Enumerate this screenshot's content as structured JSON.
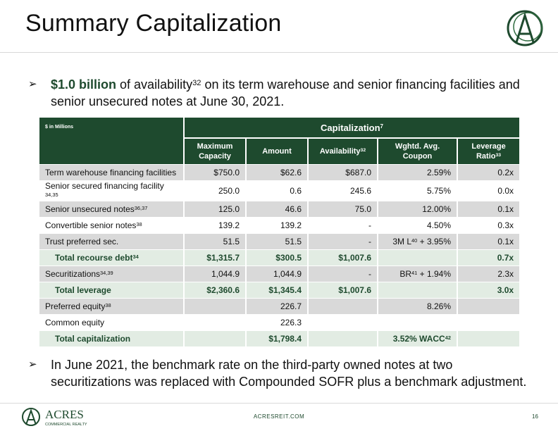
{
  "title": "Summary Capitalization",
  "bullet1": {
    "arrow": "➢",
    "bold": "$1.0 billion",
    "text_a": " of availability",
    "sup": "32",
    "text_b": " on its term warehouse and senior financing facilities and",
    "line2": "senior unsecured notes at June 30, 2021."
  },
  "table": {
    "corner_label": "$ in Millions",
    "group_header": "Capitalization",
    "group_header_sup": "7",
    "columns": [
      {
        "label": "Maximum Capacity",
        "sup": ""
      },
      {
        "label": "Amount",
        "sup": ""
      },
      {
        "label": "Availability",
        "sup": "32"
      },
      {
        "label": "Wghtd. Avg. Coupon",
        "sup": ""
      },
      {
        "label": "Leverage Ratio",
        "sup": "33"
      }
    ],
    "rows": [
      {
        "label": "Term warehouse financing facilities",
        "sup": "",
        "cells": [
          "$750.0",
          "$62.6",
          "$687.0",
          "2.59%",
          "0.2x"
        ],
        "style": "grey"
      },
      {
        "label": "Senior secured financing facility",
        "sup": " 34,35",
        "cells": [
          "250.0",
          "0.6",
          "245.6",
          "5.75%",
          "0.0x"
        ],
        "style": "white"
      },
      {
        "label": "Senior unsecured notes",
        "sup": "36,37",
        "cells": [
          "125.0",
          "46.6",
          "75.0",
          "12.00%",
          "0.1x"
        ],
        "style": "grey"
      },
      {
        "label": "Convertible senior notes",
        "sup": "38",
        "cells": [
          "139.2",
          "139.2",
          "-",
          "4.50%",
          "0.3x"
        ],
        "style": "white"
      },
      {
        "label": "Trust preferred sec.",
        "sup": "",
        "cells": [
          "51.5",
          "51.5",
          "-",
          "3M L40 + 3.95%",
          "0.1x"
        ],
        "style": "grey"
      },
      {
        "label": "Total recourse debt",
        "sup": "34",
        "cells": [
          "$1,315.7",
          "$300.5",
          "$1,007.6",
          "",
          "0.7x"
        ],
        "style": "tot"
      },
      {
        "label": "Securitizations",
        "sup": "34,39",
        "cells": [
          "1,044.9",
          "1,044.9",
          "-",
          "BR41 + 1.94%",
          "2.3x"
        ],
        "style": "grey"
      },
      {
        "label": "Total leverage",
        "sup": "",
        "cells": [
          "$2,360.6",
          "$1,345.4",
          "$1,007.6",
          "",
          "3.0x"
        ],
        "style": "tot"
      },
      {
        "label": "Preferred equity",
        "sup": "38",
        "cells": [
          "",
          "226.7",
          "",
          "8.26%",
          ""
        ],
        "style": "grey"
      },
      {
        "label": "Common equity",
        "sup": "",
        "cells": [
          "",
          "226.3",
          "",
          "",
          ""
        ],
        "style": "white"
      },
      {
        "label": "Total capitalization",
        "sup": "",
        "cells": [
          "",
          "$1,798.4",
          "",
          "3.52% WACC42",
          ""
        ],
        "style": "tot"
      }
    ]
  },
  "bullet2": {
    "arrow": "➢",
    "line1": "In June 2021, the benchmark rate on the third-party owned notes at two",
    "line2": "securitizations was replaced with Compounded SOFR plus a benchmark adjustment."
  },
  "footer": {
    "url": "ACRESREIT.COM",
    "page": "16",
    "logo_text": "ACRES",
    "logo_sub": "COMMERCIAL REALTY"
  },
  "colors": {
    "brand_green": "#1e4a2e",
    "row_grey": "#d9d9d9",
    "total_row": "#e2ece3"
  }
}
